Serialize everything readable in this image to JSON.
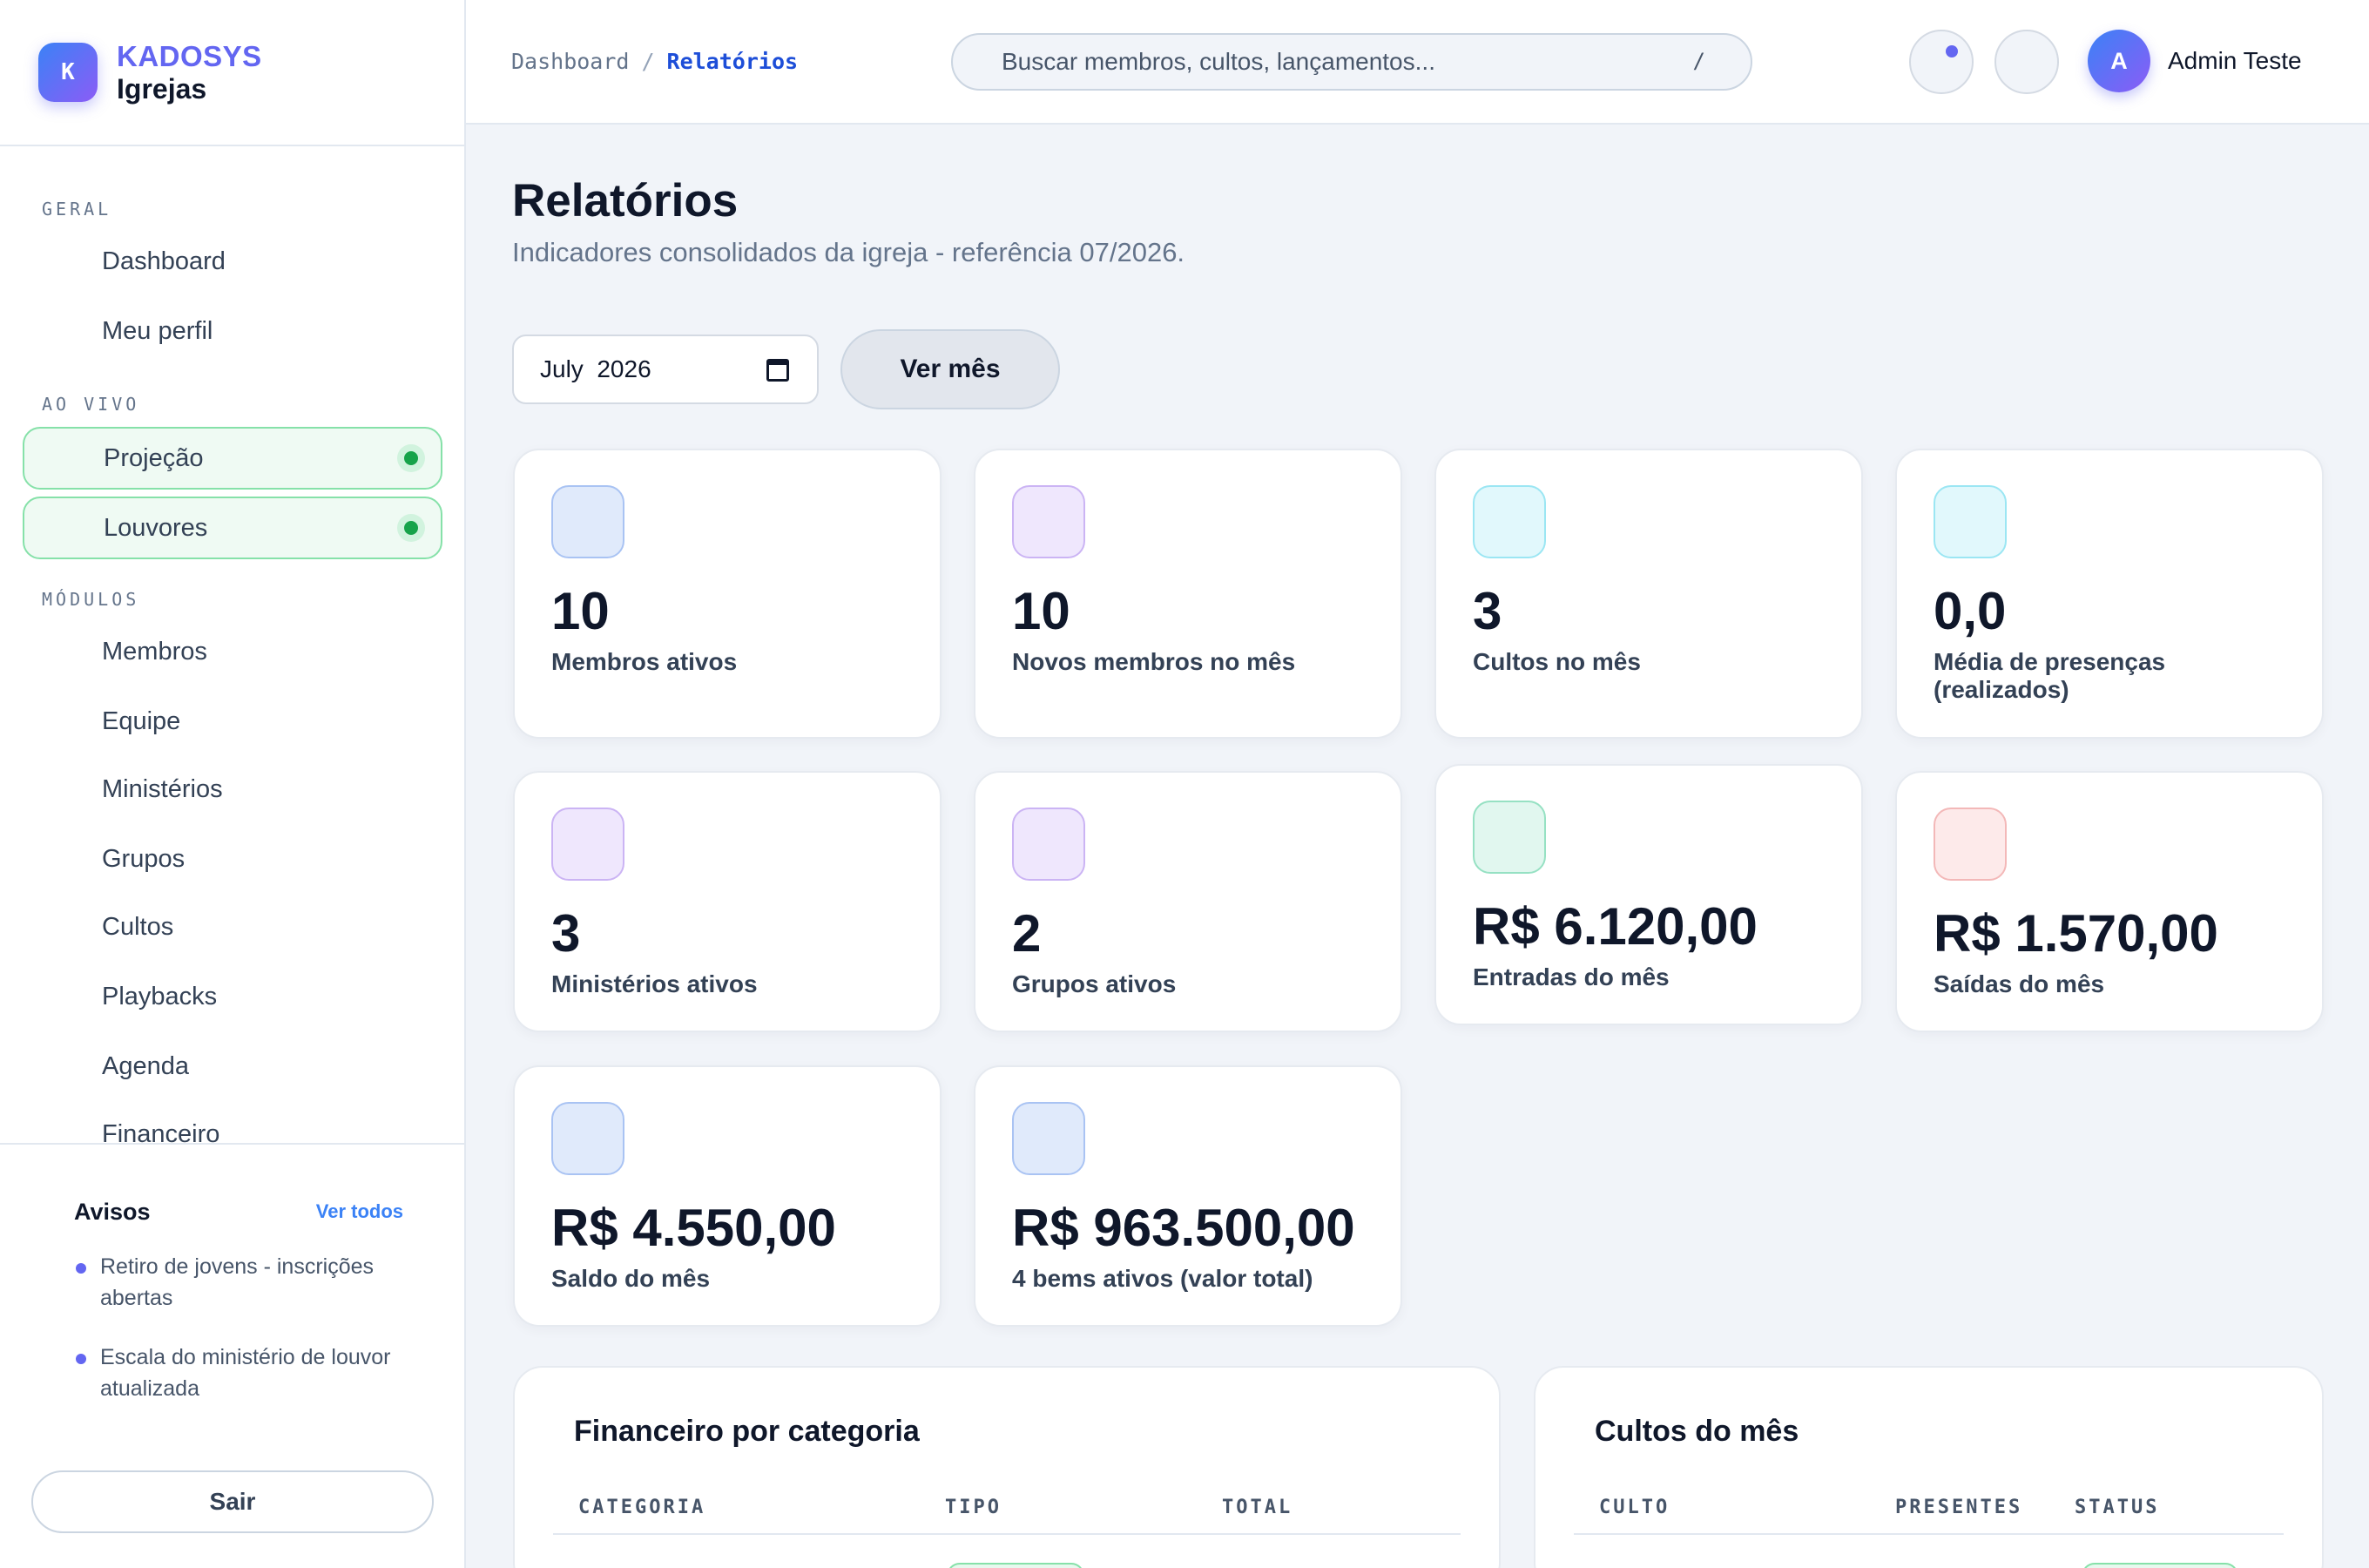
{
  "brand": {
    "logo_letter": "K",
    "name": "KADOSYS",
    "subtitle": "Igrejas"
  },
  "sidebar": {
    "sections": [
      {
        "title": "GERAL",
        "items": [
          {
            "label": "Dashboard"
          },
          {
            "label": "Meu perfil"
          }
        ]
      },
      {
        "title": "AO VIVO",
        "items": [
          {
            "label": "Projeção",
            "live": true
          },
          {
            "label": "Louvores",
            "live": true
          }
        ]
      },
      {
        "title": "MÓDULOS",
        "items": [
          {
            "label": "Membros"
          },
          {
            "label": "Equipe"
          },
          {
            "label": "Ministérios"
          },
          {
            "label": "Grupos"
          },
          {
            "label": "Cultos"
          },
          {
            "label": "Playbacks"
          },
          {
            "label": "Agenda"
          },
          {
            "label": "Financeiro"
          }
        ]
      }
    ],
    "notices": {
      "title": "Avisos",
      "link": "Ver todos",
      "items": [
        "Retiro de jovens - inscrições abertas",
        "Escala do ministério de louvor atualizada"
      ]
    },
    "logout_label": "Sair"
  },
  "header": {
    "breadcrumb": {
      "parent": "Dashboard",
      "separator": "/",
      "current": "Relatórios"
    },
    "search": {
      "placeholder": "Buscar membros, cultos, lançamentos...",
      "shortcut": "/"
    },
    "user": {
      "initial": "A",
      "name": "Admin Teste"
    }
  },
  "page": {
    "title": "Relatórios",
    "subtitle": "Indicadores consolidados da igreja - referência 07/2026.",
    "month_input": "July  2026",
    "view_button": "Ver mês"
  },
  "stats": [
    {
      "value": "10",
      "label": "Membros ativos",
      "color": "blue"
    },
    {
      "value": "10",
      "label": "Novos membros no mês",
      "color": "purple"
    },
    {
      "value": "3",
      "label": "Cultos no mês",
      "color": "cyan"
    },
    {
      "value": "0,0",
      "label": "Média de presenças (realizados)",
      "color": "cyan"
    },
    {
      "value": "3",
      "label": "Ministérios ativos",
      "color": "purple"
    },
    {
      "value": "2",
      "label": "Grupos ativos",
      "color": "purple"
    },
    {
      "value": "R$ 6.120,00",
      "label": "Entradas do mês",
      "color": "green"
    },
    {
      "value": "R$ 1.570,00",
      "label": "Saídas do mês",
      "color": "red"
    },
    {
      "value": "R$ 4.550,00",
      "label": "Saldo do mês",
      "color": "blue"
    },
    {
      "value": "R$ 963.500,00",
      "label": "4 bems ativos (valor total)",
      "color": "blue"
    }
  ],
  "financeiro_panel": {
    "title": "Financeiro por categoria",
    "columns": [
      "CATEGORIA",
      "TIPO",
      "TOTAL"
    ]
  },
  "cultos_panel": {
    "title": "Cultos do mês",
    "columns": [
      "CULTO",
      "PRESENTES",
      "STATUS"
    ]
  },
  "colors": {
    "accent": "#6366f1",
    "link": "#1d4ed8",
    "live": "#16a34a"
  }
}
